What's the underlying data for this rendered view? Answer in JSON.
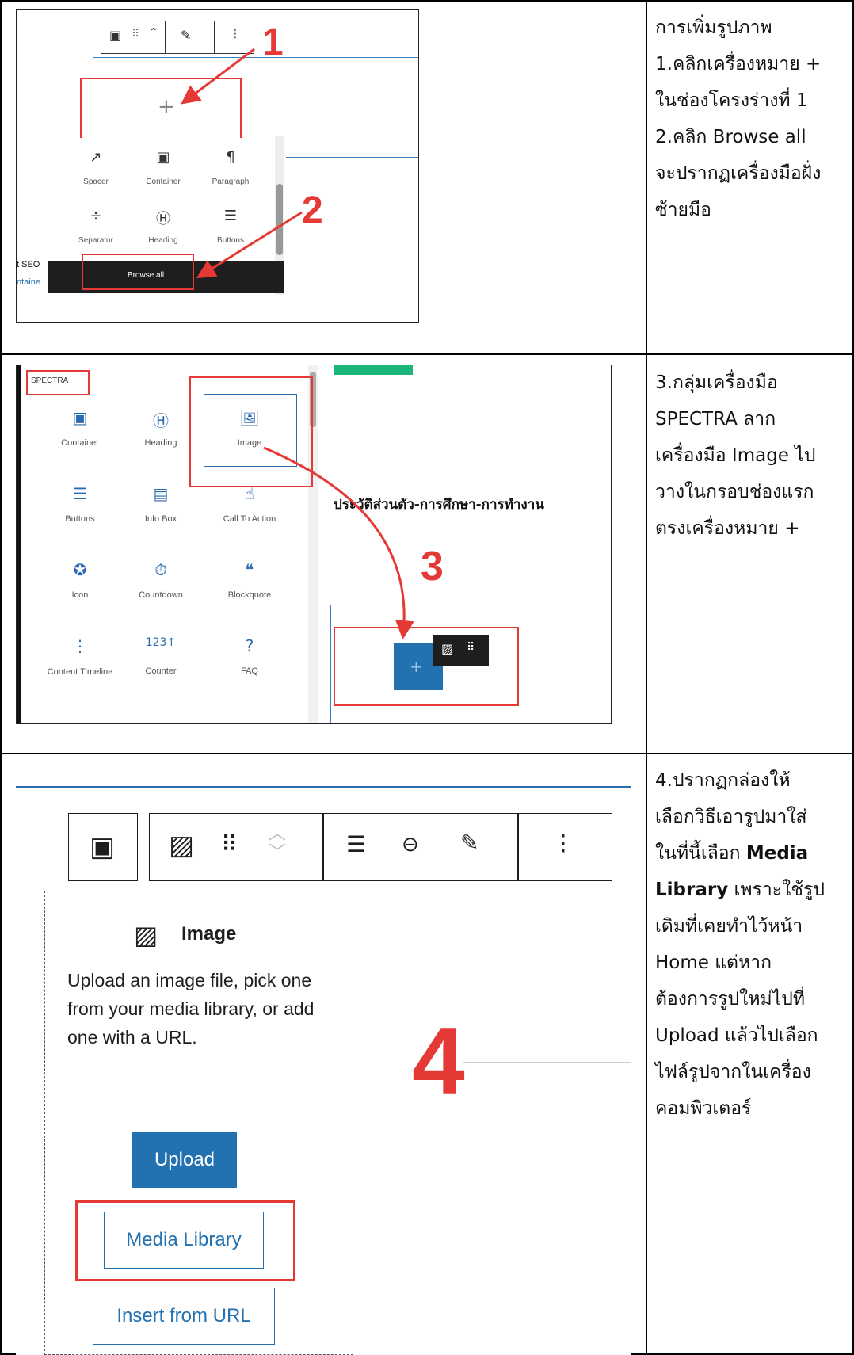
{
  "row1": {
    "text": [
      "การเพิ่มรูปภาพ",
      "1.คลิกเครื่องหมาย +",
      "ในช่องโครงร่างที่ 1",
      "2.คลิก Browse all",
      "จะปรากฏเครื่องมือฝั่ง",
      "ซ้ายมือ"
    ],
    "shot": {
      "blocks": [
        "Spacer",
        "Container",
        "Paragraph",
        "Separator",
        "Heading",
        "Buttons"
      ],
      "browse_all": "Browse all",
      "side_seo": "t SEO",
      "side_container": "ntaine",
      "plus": "+",
      "marker1": "1",
      "marker2": "2"
    }
  },
  "row2": {
    "text": [
      "3.กลุ่มเครื่องมือ",
      "SPECTRA ลาก",
      "เครื่องมือ Image ไป",
      "วางในกรอบช่องแรก",
      "ตรงเครื่องหมาย +"
    ],
    "shot": {
      "group": "SPECTRA",
      "blocks": [
        "Container",
        "Heading",
        "Image",
        "Buttons",
        "Info Box",
        "Call To Action",
        "Icon",
        "Countdown",
        "Blockquote",
        "Content Timeline",
        "Counter",
        "FAQ"
      ],
      "heading": "ประวัติส่วนตัว-การศึกษา-การทำงาน",
      "marker3": "3",
      "plus": "+"
    }
  },
  "row3": {
    "text_lines": [
      {
        "t": "4.ปรากฏกล่องให้"
      },
      {
        "t": "เลือกวิธีเอารูปมาใส่"
      },
      {
        "t": "ในที่นี้เลือก ",
        "b": "Media"
      },
      {
        "b": "Library",
        "t": " เพราะใช้รูป"
      },
      {
        "t": "เดิมที่เคยทำไว้หน้า"
      },
      {
        "t": "Home แต่หาก"
      },
      {
        "t": "ต้องการรูปใหม่ไปที่"
      },
      {
        "t": "Upload แล้วไปเลือก"
      },
      {
        "t": "ไฟล์รูปจากในเครื่อง"
      },
      {
        "t": "คอมพิวเตอร์"
      }
    ],
    "shot": {
      "title": "Image",
      "description": "Upload an image file, pick one from your media library, or add one with a URL.",
      "upload": "Upload",
      "media_library": "Media Library",
      "insert_url": "Insert from URL",
      "marker4": "4"
    }
  },
  "colors": {
    "accent": "#2271b1",
    "red": "#e53935",
    "dark": "#1e1e1e"
  }
}
